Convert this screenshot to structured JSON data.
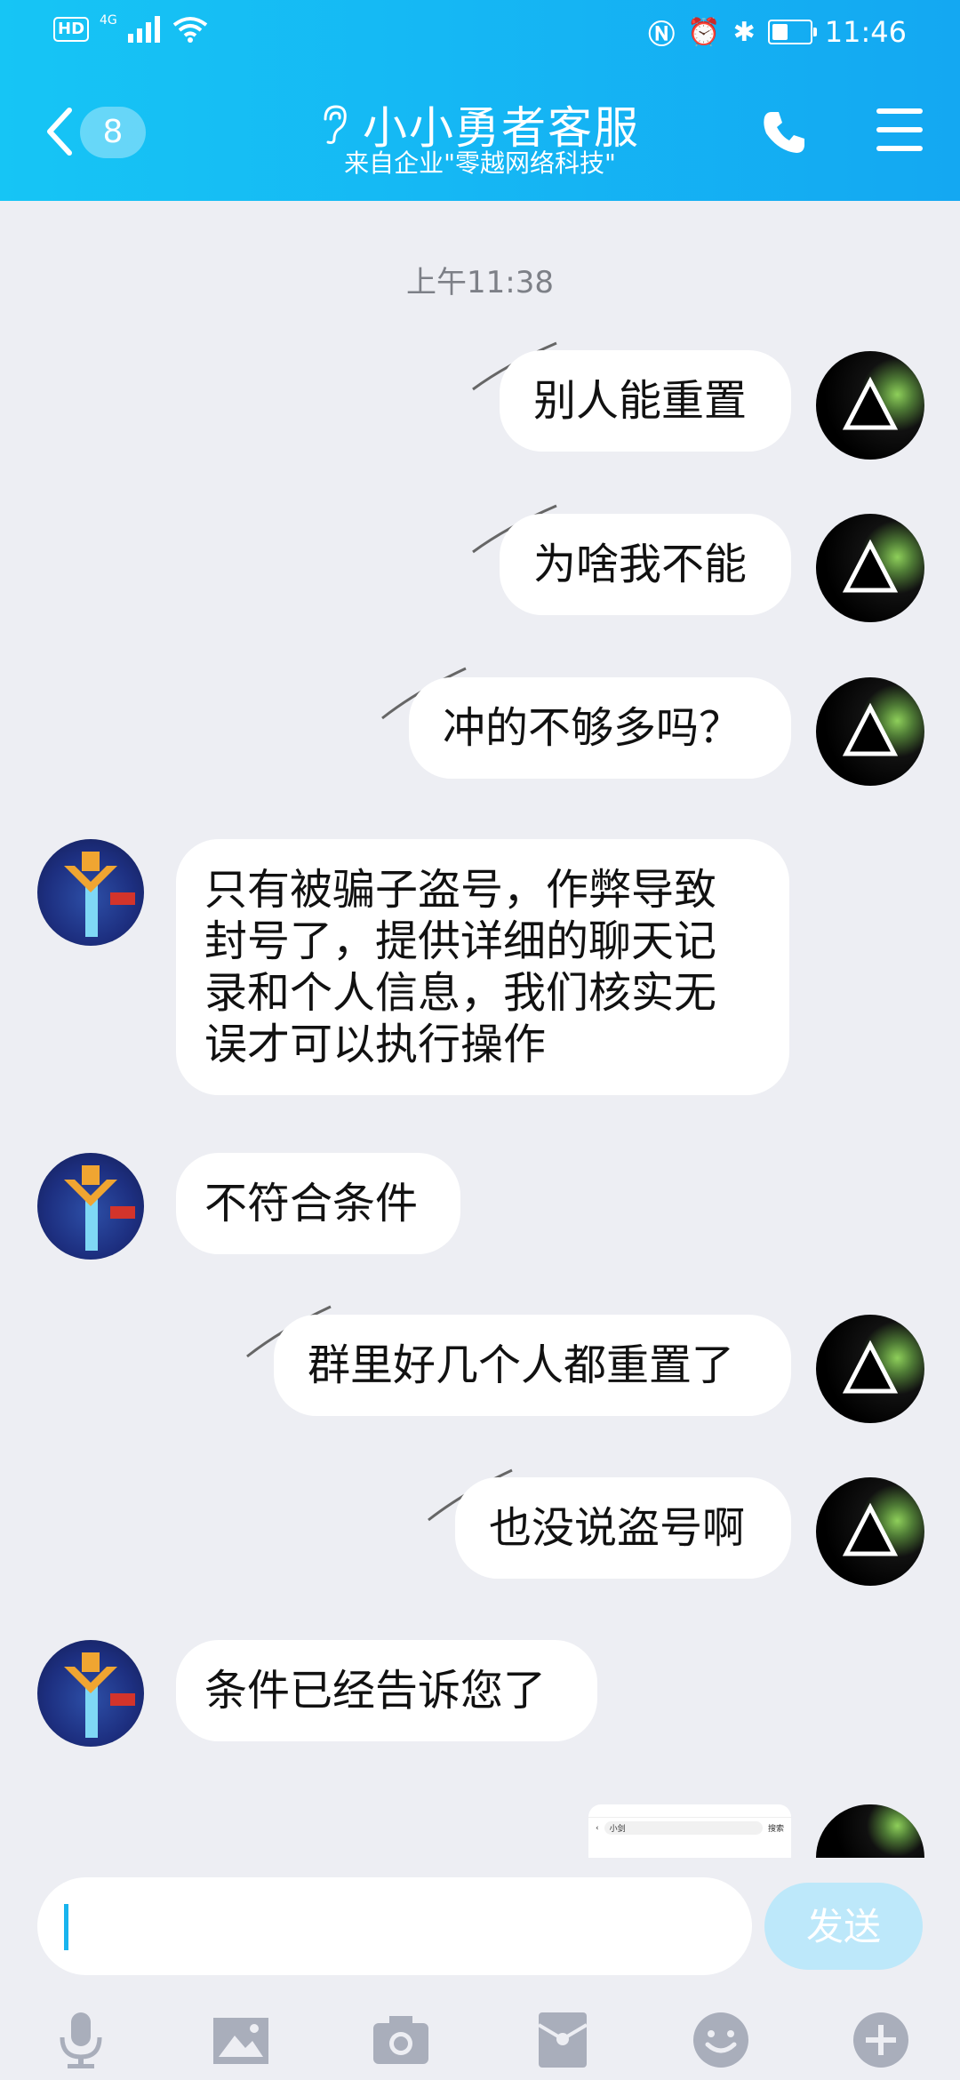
{
  "status_bar": {
    "network": "HD",
    "signal_type": "4G",
    "time": "11:46",
    "battery_level": 0.45
  },
  "header": {
    "unread_count": "8",
    "title": "小小勇者客服",
    "subtitle": "来自企业\"零越网络科技\""
  },
  "chat": {
    "timestamp": "上午11:38",
    "messages": [
      {
        "side": "right",
        "text": "别人能重置"
      },
      {
        "side": "right",
        "text": "为啥我不能"
      },
      {
        "side": "right",
        "text": "冲的不够多吗？"
      },
      {
        "side": "left",
        "lines": [
          "只有被骗子盗号，作弊导致",
          "封号了，提供详细的聊天记",
          "录和个人信息，我们核实无",
          "误才可以执行操作"
        ]
      },
      {
        "side": "left",
        "text": "不符合条件"
      },
      {
        "side": "right",
        "text": "群里好几个人都重置了"
      },
      {
        "side": "right",
        "text": "也没说盗号啊"
      },
      {
        "side": "left",
        "text": "条件已经告诉您了"
      }
    ],
    "image_preview": {
      "search_text": "小剑",
      "search_button": "搜索"
    }
  },
  "input": {
    "placeholder": "",
    "send_label": "发送"
  },
  "toolbar": [
    "mic-icon",
    "image-icon",
    "camera-icon",
    "red-packet-icon",
    "emoji-icon",
    "plus-icon"
  ],
  "colors": {
    "header_start": "#16C5F5",
    "header_end": "#14A8F2",
    "background": "#EDEEF3",
    "send_disabled": "#BDE8FA",
    "cursor": "#18B4EE"
  }
}
